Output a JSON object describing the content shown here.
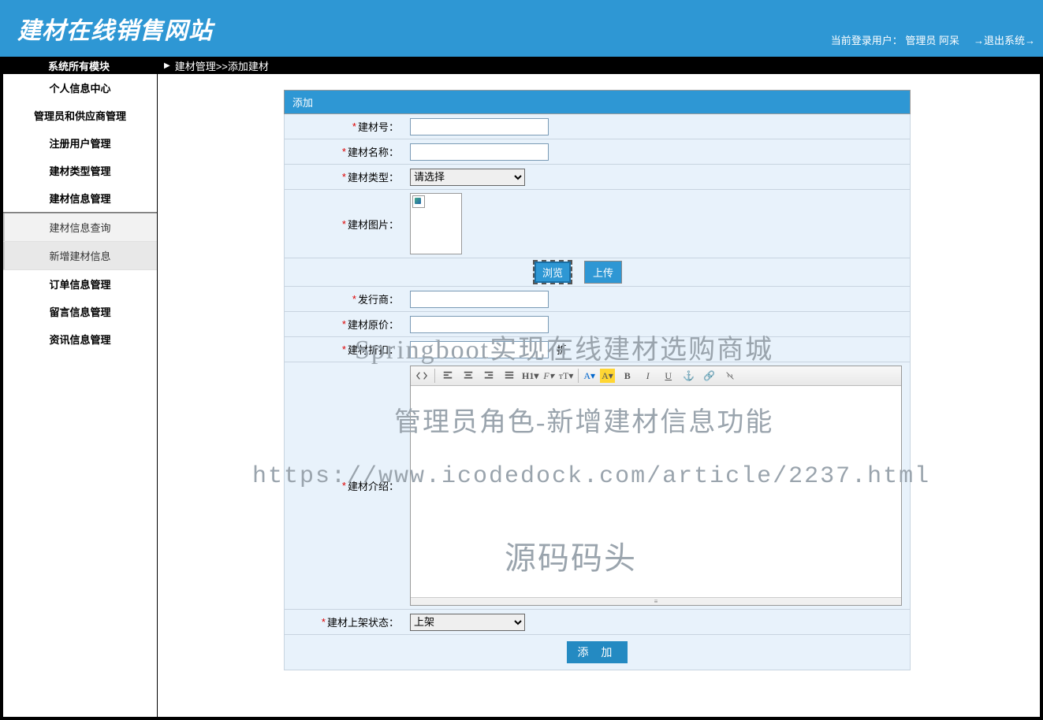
{
  "header": {
    "site_title": "建材在线销售网站",
    "current_user_label": "当前登录用户：",
    "current_user_role": "管理员 阿呆",
    "logout": "→退出系统→"
  },
  "blackbar": {
    "left": "系统所有模块",
    "breadcrumb": "建材管理>>添加建材"
  },
  "sidebar": {
    "items": [
      "个人信息中心",
      "管理员和供应商管理",
      "注册用户管理",
      "建材类型管理",
      "建材信息管理"
    ],
    "sub_items": [
      "建材信息查询",
      "新增建材信息"
    ],
    "items_after": [
      "订单信息管理",
      "留言信息管理",
      "资讯信息管理"
    ]
  },
  "form": {
    "header": "添加",
    "fields": {
      "material_no": "建材号：",
      "material_name": "建材名称：",
      "material_type": "建材类型：",
      "material_type_placeholder": "请选择",
      "material_image": "建材图片：",
      "browse_btn": "浏览",
      "upload_btn": "上传",
      "publisher": "发行商：",
      "original_price": "建材原价：",
      "discount": "建材折扣：",
      "discount_suffix": "折",
      "description": "建材介绍：",
      "shelf_status": "建材上架状态：",
      "shelf_status_value": "上架"
    },
    "submit": "添 加"
  },
  "editor": {
    "h1": "H1",
    "font": "F",
    "size": "ᴛT",
    "color_a": "A",
    "hilite_a": "A",
    "bold": "B",
    "italic": "I",
    "underline": "U"
  },
  "watermarks": {
    "w1": "Springboot实现在线建材选购商城",
    "w2": "管理员角色-新增建材信息功能",
    "w3": "https://www.icodedock.com/article/2237.html",
    "w4": "源码码头"
  }
}
